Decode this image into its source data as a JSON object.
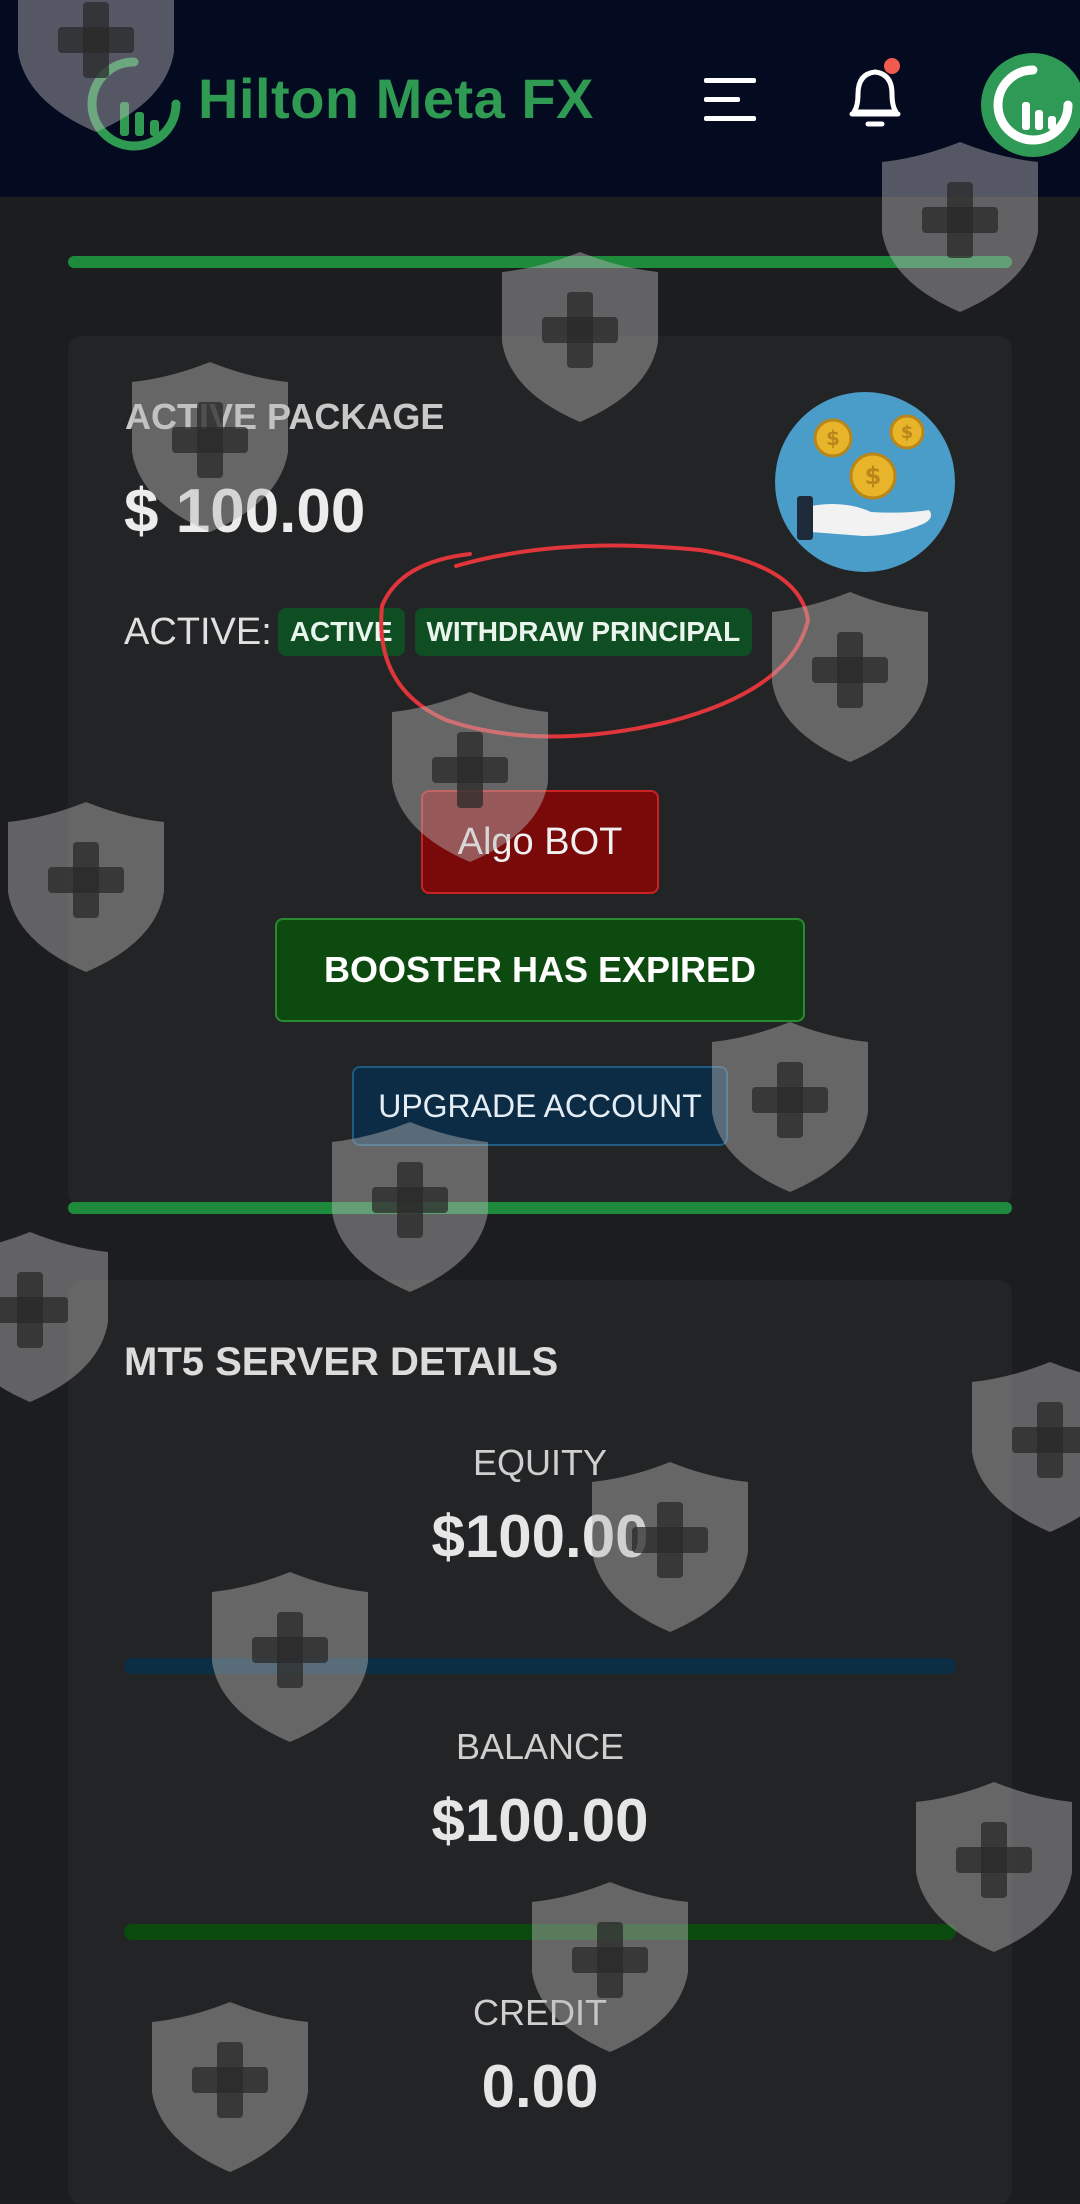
{
  "header": {
    "brand": "Hilton Meta FX",
    "icons": {
      "logo": "chart-logo-icon",
      "menu": "hamburger-menu-icon",
      "notifications": "bell-icon",
      "profile": "avatar-logo-icon"
    },
    "colors": {
      "brand": "#2f9a52",
      "background": "#040a1f",
      "notification_dot": "#f05a4f"
    }
  },
  "package_card": {
    "label": "ACTIVE PACKAGE",
    "amount": "$ 100.00",
    "status_label": "ACTIVE:",
    "badges": [
      "ACTIVE",
      "WITHDRAW PRINCIPAL"
    ],
    "illustration": "coins-hand-icon",
    "buttons": {
      "algo_bot": "Algo BOT",
      "booster": "BOOSTER HAS EXPIRED",
      "upgrade": "UPGRADE ACCOUNT"
    },
    "annotation": "red hand-drawn circle around WITHDRAW PRINCIPAL"
  },
  "server_card": {
    "title": "MT5 SERVER DETAILS",
    "metrics": [
      {
        "label": "EQUITY",
        "value": "$100.00",
        "bar_color": "#0b2e45"
      },
      {
        "label": "BALANCE",
        "value": "$100.00",
        "bar_color": "#0b4a0f"
      },
      {
        "label": "CREDIT",
        "value": "0.00"
      }
    ]
  },
  "watermark": "shield-plus-icon"
}
